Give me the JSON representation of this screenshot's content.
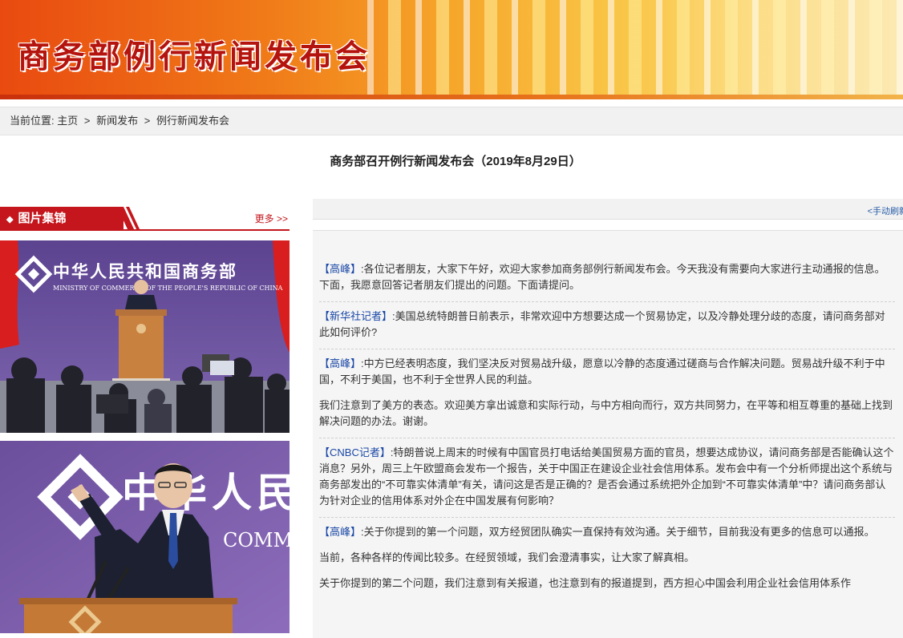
{
  "banner": {
    "title": "商务部例行新闻发布会"
  },
  "breadcrumb": {
    "prefix": "当前位置:",
    "items": [
      "主页",
      "新闻发布",
      "例行新闻发布会"
    ],
    "separator": ">"
  },
  "page_title": "商务部召开例行新闻发布会（2019年8月29日）",
  "gallery": {
    "title": "图片集锦",
    "more_label": "更多 >>",
    "photo1": {
      "sign_cn": "中华人民共和国商务部",
      "sign_en": "MINISTRY OF COMMERCE OF THE PEOPLE'S REPUBLIC OF CHINA"
    },
    "photo2": {
      "sign_cn": "中华人民",
      "sign_en": "COMMERC"
    }
  },
  "refresh_label": "<手动刷新",
  "transcript": [
    {
      "speaker": "【高峰】",
      "text": ":各位记者朋友，大家下午好，欢迎大家参加商务部例行新闻发布会。今天我没有需要向大家进行主动通报的信息。下面，我愿意回答记者朋友们提出的问题。下面请提问。",
      "extra": []
    },
    {
      "speaker": "【新华社记者】",
      "text": ":美国总统特朗普日前表示，非常欢迎中方想要达成一个贸易协定，以及冷静处理分歧的态度，请问商务部对此如何评价?",
      "extra": []
    },
    {
      "speaker": "【高峰】",
      "text": ":中方已经表明态度，我们坚决反对贸易战升级，愿意以冷静的态度通过磋商与合作解决问题。贸易战升级不利于中国，不利于美国，也不利于全世界人民的利益。",
      "extra": [
        "我们注意到了美方的表态。欢迎美方拿出诚意和实际行动，与中方相向而行，双方共同努力，在平等和相互尊重的基础上找到解决问题的办法。谢谢。"
      ]
    },
    {
      "speaker": "【CNBC记者】",
      "text": ":特朗普说上周末的时候有中国官员打电话给美国贸易方面的官员，想要达成协议，请问商务部是否能确认这个消息？另外，周三上午欧盟商会发布一个报告，关于中国正在建设企业社会信用体系。发布会中有一个分析师提出这个系统与商务部发出的“不可靠实体清单”有关，请问这是否是正确的？是否会通过系统把外企加到“不可靠实体清单”中？请问商务部认为针对企业的信用体系对外企在中国发展有何影响？",
      "extra": []
    },
    {
      "speaker": "【高峰】",
      "text": ":关于你提到的第一个问题，双方经贸团队确实一直保持有效沟通。关于细节，目前我没有更多的信息可以通报。",
      "extra": [
        "当前，各种各样的传闻比较多。在经贸领域，我们会澄清事实，让大家了解真相。",
        "关于你提到的第二个问题，我们注意到有关报道，也注意到有的报道提到，西方担心中国会利用企业社会信用体系作"
      ]
    }
  ],
  "colors": {
    "brand_red": "#c4161c",
    "speaker_blue": "#1a48a6",
    "banner_title": "#b5140e"
  }
}
